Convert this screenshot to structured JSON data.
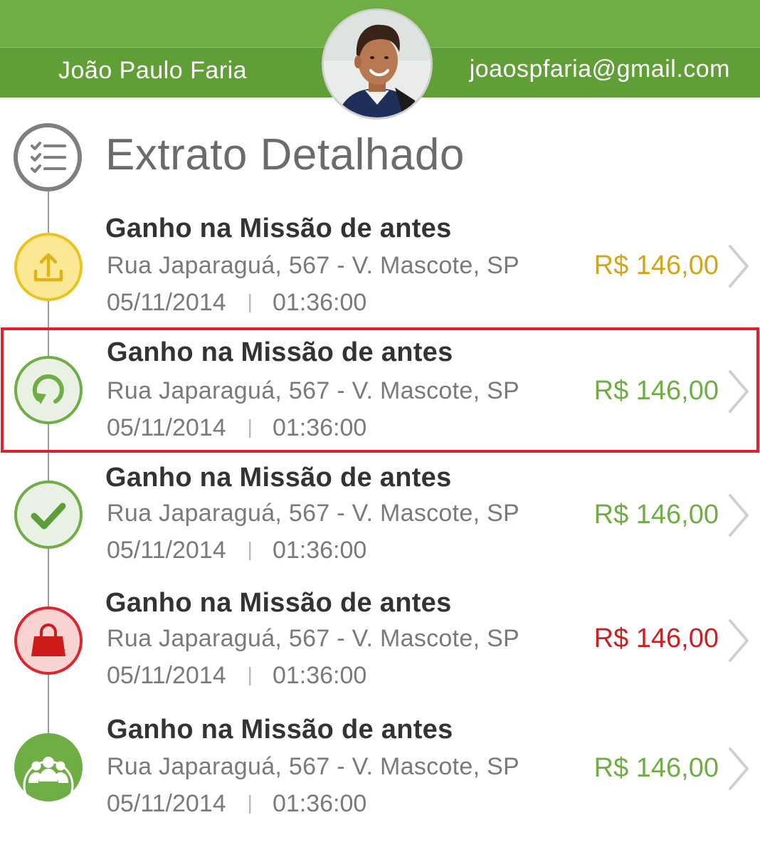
{
  "header": {
    "user_name": "João Paulo Faria",
    "user_email": "joaospfaria@gmail.com",
    "accent_color": "#6fad45"
  },
  "section": {
    "title": "Extrato Detalhado",
    "icon": "checklist-icon"
  },
  "transactions": [
    {
      "title": "Ganho na Missão de antes",
      "address": "Rua Japaraguá, 567 - V. Mascote, SP",
      "date": "05/11/2014",
      "separator": "|",
      "time": "01:36:00",
      "amount": "R$ 146,00",
      "status_icon": "upload-icon",
      "status_color": "#e9c31f",
      "amount_color": "#d3a51a"
    },
    {
      "title": "Ganho na Missão de antes",
      "address": "Rua Japaraguá, 567 - V. Mascote, SP",
      "date": "05/11/2014",
      "separator": "|",
      "time": "01:36:00",
      "amount": "R$ 146,00",
      "status_icon": "refresh-icon",
      "status_color": "#6fad45",
      "amount_color": "#6fad45",
      "selected": true
    },
    {
      "title": "Ganho na Missão de antes",
      "address": "Rua Japaraguá, 567 - V. Mascote, SP",
      "date": "05/11/2014",
      "separator": "|",
      "time": "01:36:00",
      "amount": "R$ 146,00",
      "status_icon": "checkmark-icon",
      "status_color": "#6fad45",
      "amount_color": "#6fad45"
    },
    {
      "title": "Ganho na Missão de antes",
      "address": "Rua Japaraguá, 567 - V. Mascote, SP",
      "date": "05/11/2014",
      "separator": "|",
      "time": "01:36:00",
      "amount": "R$ 146,00",
      "status_icon": "shopping-bag-icon",
      "status_color": "#d9272e",
      "amount_color": "#cc1f1f"
    },
    {
      "title": "Ganho na Missão de antes",
      "address": "Rua Japaraguá, 567 - V. Mascote, SP",
      "date": "05/11/2014",
      "separator": "|",
      "time": "01:36:00",
      "amount": "R$ 146,00",
      "status_icon": "group-icon",
      "status_color": "#6fad45",
      "amount_color": "#6fad45"
    }
  ]
}
